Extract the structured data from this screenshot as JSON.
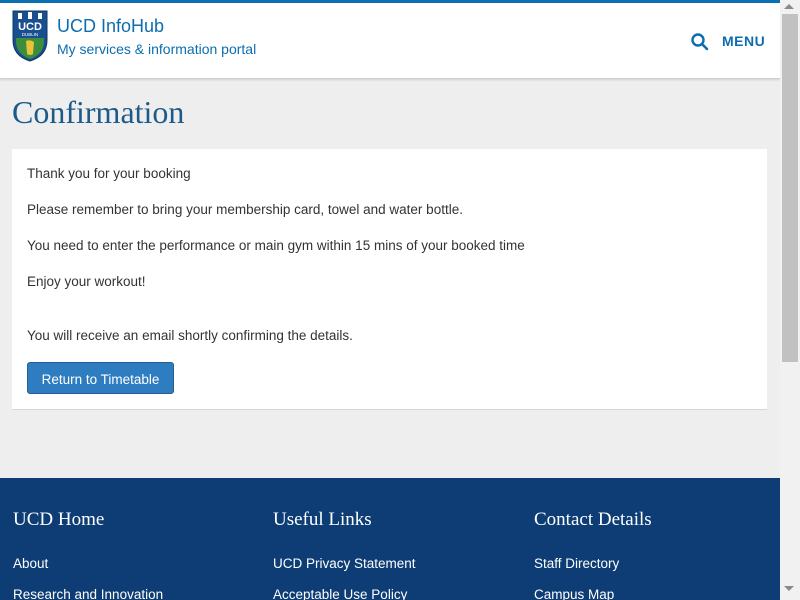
{
  "header": {
    "title": "UCD InfoHub",
    "subtitle": "My services & information portal",
    "logo_text": "UCD",
    "logo_subtext": "DUBLIN",
    "search_icon": "search-icon",
    "menu_label": "MENU"
  },
  "main": {
    "title": "Confirmation",
    "messages": [
      "Thank you for your booking",
      "Please remember to bring your membership card, towel and water bottle.",
      "You need to enter the performance or main gym within 15 mins of your booked time",
      "Enjoy your workout!",
      "You will receive an email shortly confirming the details."
    ],
    "return_button": "Return to Timetable"
  },
  "footer": {
    "columns": [
      {
        "heading": "UCD Home",
        "links": [
          "About",
          "Research and Innovation"
        ]
      },
      {
        "heading": "Useful Links",
        "links": [
          "UCD Privacy Statement",
          "Acceptable Use Policy"
        ]
      },
      {
        "heading": "Contact Details",
        "links": [
          "Staff Directory",
          "Campus Map"
        ]
      }
    ]
  },
  "colors": {
    "brand_blue": "#0d6db0",
    "title_blue": "#1c5a8a",
    "button_blue": "#2f7dc1",
    "footer_navy": "#0d3d74",
    "page_bg": "#eeeeee"
  }
}
